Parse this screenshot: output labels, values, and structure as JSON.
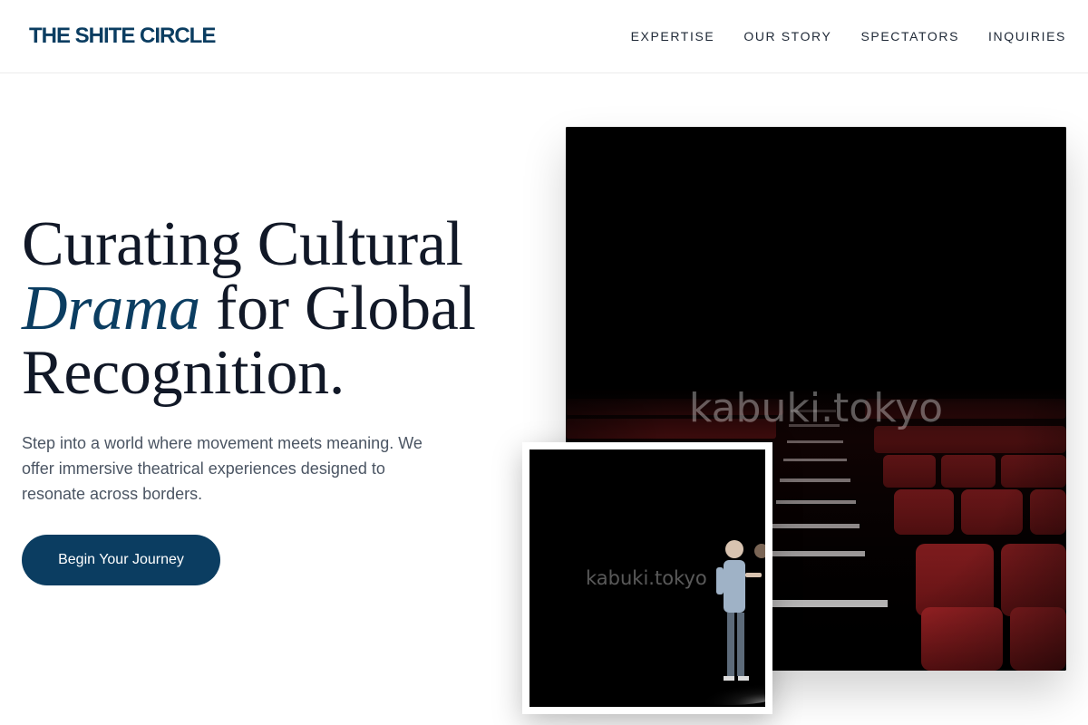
{
  "brand": {
    "name": "THE SHITE CIRCLE"
  },
  "nav": {
    "items": [
      {
        "label": "EXPERTISE"
      },
      {
        "label": "OUR STORY"
      },
      {
        "label": "SPECTATORS"
      },
      {
        "label": "INQUIRIES"
      }
    ]
  },
  "hero": {
    "headline_part1": "Curating Cultural",
    "headline_accent": "Drama",
    "headline_part2": " for Global Recognition.",
    "subtitle": "Step into a world where movement meets meaning. We offer immersive theatrical experiences designed to resonate across borders.",
    "cta_label": "Begin Your Journey"
  },
  "images": {
    "main_watermark": "kabuki.tokyo",
    "inset_watermark": "kabuki.tokyo"
  },
  "colors": {
    "brand_blue": "#0b3d61",
    "heading": "#111827",
    "body_text": "#4b5563",
    "seat_red": "#8f1d1f"
  }
}
